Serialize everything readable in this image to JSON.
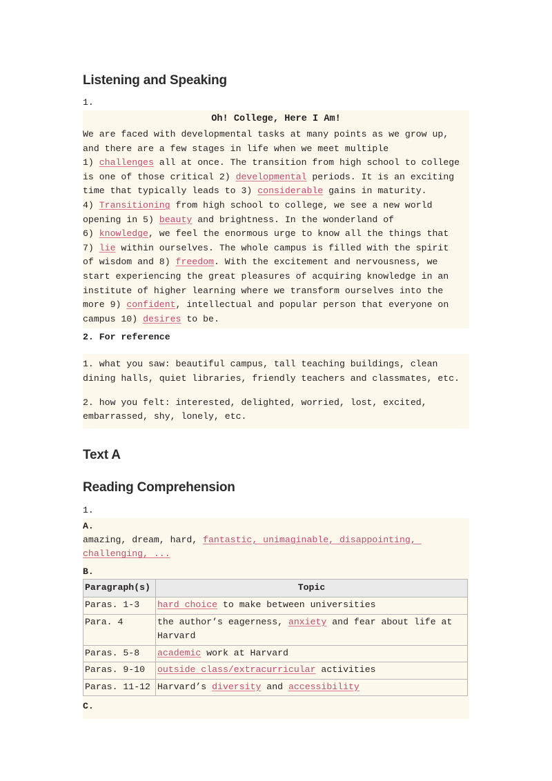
{
  "page": {
    "background": "#ffffff",
    "highlight_background": "#fdf8ec",
    "answer_color": "#c8486e",
    "table_header_background": "#eaeaea"
  },
  "sections": {
    "listening_speaking": {
      "heading": "Listening and Speaking",
      "item1_marker": "1.",
      "passage_title": "Oh! College, Here I Am!",
      "passage": {
        "p1_a": "We are faced with developmental tasks at many points as we grow up,",
        "p1_b": "and there are a few stages in life when we meet multiple",
        "p1_c_num": "1) ",
        "ans1": "challenges",
        "p1_d": " all at once. The transition from high school to college",
        "p1_e": "is one of those critical 2) ",
        "ans2": "developmental",
        "p1_f": " periods. It is an exciting",
        "p1_g": "time that typically leads to 3) ",
        "ans3": "considerable",
        "p1_h": " gains in maturity.",
        "p1_i": "4) ",
        "ans4": "Transitioning",
        "p1_j": " from high school to college, we see a new world",
        "p1_k": "opening in 5) ",
        "ans5": "beauty",
        "p1_l": " and brightness. In the wonderland of",
        "p1_m": "6) ",
        "ans6": "knowledge",
        "p1_n": ", we feel the enormous urge to know all the things that",
        "p1_o": "7) ",
        "ans7": "lie",
        "p1_p": " within ourselves. The whole campus is filled with the spirit",
        "p1_q": "of wisdom and 8) ",
        "ans8": "freedom",
        "p1_r": ". With the excitement and nervousness, we",
        "p1_s": "start experiencing the great pleasures of acquiring knowledge in an",
        "p1_t": "institute of higher learning where we transform ourselves into the",
        "p1_u": "more 9) ",
        "ans9": "confident",
        "p1_v": ", intellectual and popular person that everyone on",
        "p1_w": "campus 10) ",
        "ans10": "desires",
        "p1_x": " to be."
      },
      "item2_marker": "2. For reference",
      "reference": {
        "line1": "1. what you saw: beautiful campus, tall teaching buildings, clean",
        "line2": "dining halls, quiet libraries, friendly teachers and classmates, etc.",
        "line3": "2. how you felt: interested, delighted, worried, lost, excited,",
        "line4": "embarrassed, shy, lonely, etc."
      }
    },
    "text_a": {
      "heading": "Text A"
    },
    "reading_comprehension": {
      "heading": "Reading Comprehension",
      "item1_marker": "1.",
      "part_a": {
        "label": "A.",
        "given": "amazing, dream, hard, ",
        "answer_line1": "fantastic, unimaginable, disappointing, ",
        "answer_line2": "challenging, ..."
      },
      "part_b": {
        "label": "B.",
        "columns": [
          "Paragraph(s)",
          "Topic"
        ],
        "rows": [
          {
            "paragraph": "Paras. 1-3",
            "topic_answer": "hard choice",
            "topic_rest": " to make between universities",
            "topic_prefix": ""
          },
          {
            "paragraph": "Para. 4",
            "topic_prefix": "the author’s eagerness, ",
            "topic_answer": "anxiety",
            "topic_rest": " and fear about life at Harvard"
          },
          {
            "paragraph": "Paras. 5-8",
            "topic_prefix": "",
            "topic_answer": "academic",
            "topic_rest": " work at Harvard"
          },
          {
            "paragraph": "Paras. 9-10",
            "topic_prefix": "",
            "topic_answer": "outside class/extracurricular",
            "topic_rest": " activities"
          },
          {
            "paragraph": "Paras. 11-12",
            "topic_prefix": "Harvard’s ",
            "topic_answer": "diversity",
            "topic_rest": " and ",
            "topic_answer2": "accessibility"
          }
        ]
      },
      "part_c": {
        "label": "C."
      }
    }
  }
}
